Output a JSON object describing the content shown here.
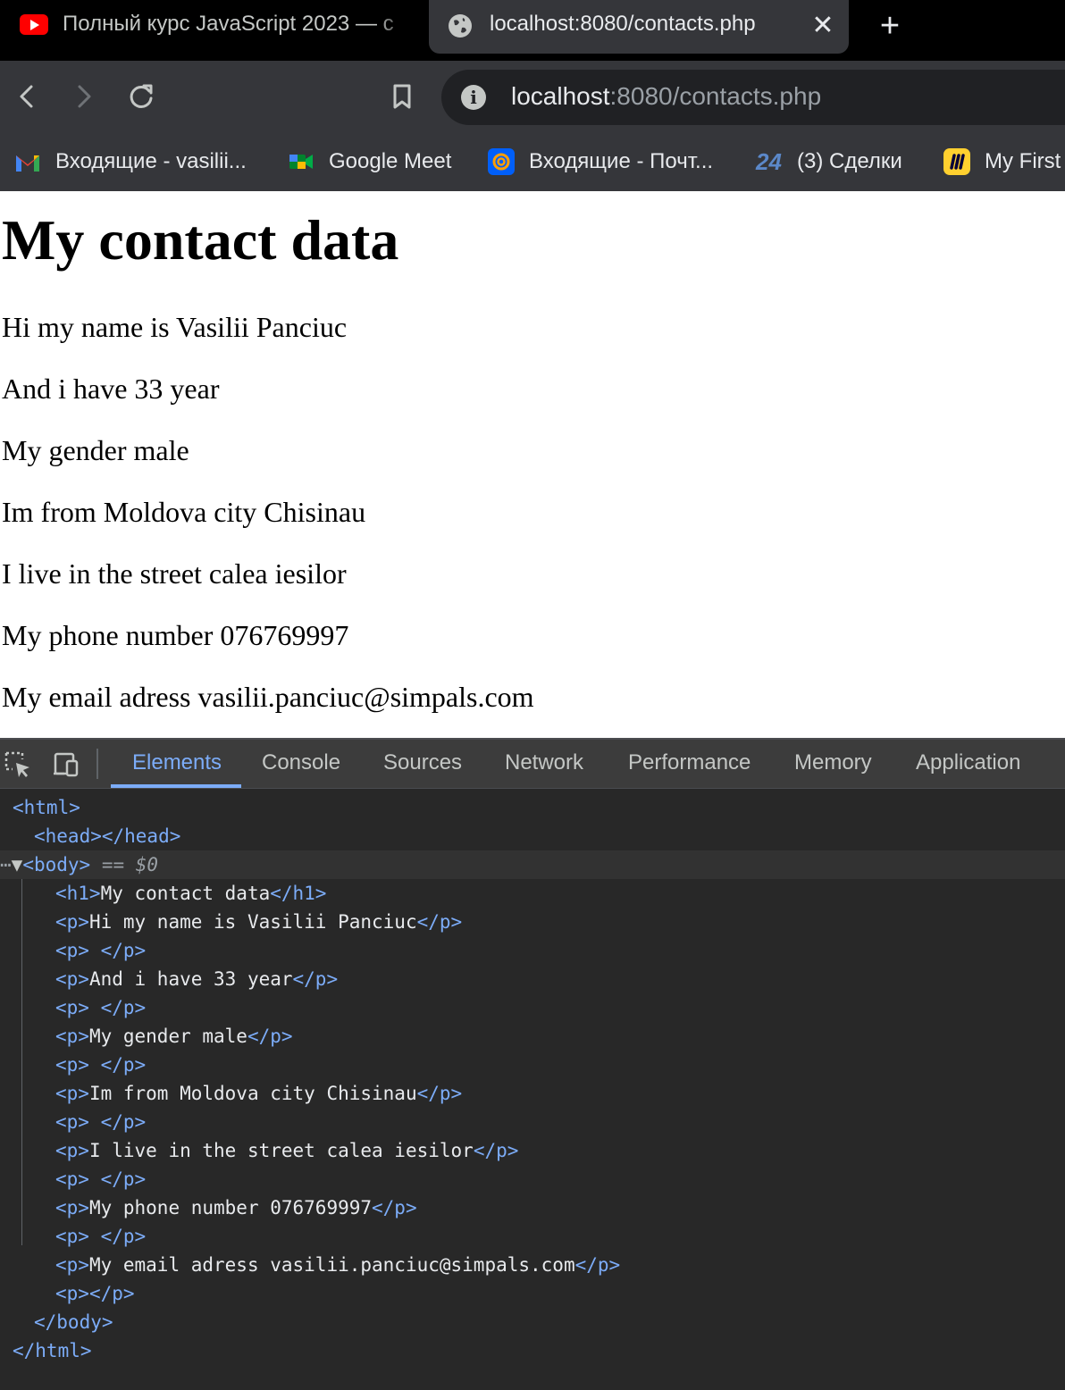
{
  "browser": {
    "tabs": [
      {
        "title": "Полный курс JavaScript 2023 — с",
        "icon": "youtube-icon",
        "active": false
      },
      {
        "title": "localhost:8080/contacts.php",
        "icon": "globe-icon",
        "active": true,
        "close": "✕"
      }
    ],
    "new_tab": "+",
    "url_host": "localhost",
    "url_rest": ":8080/contacts.php",
    "bookmarks": [
      {
        "label": "Входящие - vasilii...",
        "icon": "gmail-icon"
      },
      {
        "label": "Google Meet",
        "icon": "google-meet-icon"
      },
      {
        "label": "Входящие - Почт...",
        "icon": "mail-ru-icon"
      },
      {
        "label": "(3) Сделки",
        "icon": "bitrix24-icon",
        "icon_text": "24"
      },
      {
        "label": "My First",
        "icon": "miro-icon"
      }
    ]
  },
  "page": {
    "heading": "My contact data",
    "paragraphs": [
      "Hi my name is Vasilii Panciuc",
      "And i have 33 year",
      "My gender male",
      "Im from Moldova city Chisinau",
      "I live in the street calea iesilor",
      "My phone number 076769997",
      "My email adress vasilii.panciuc@simpals.com"
    ]
  },
  "devtools": {
    "tabs": [
      "Elements",
      "Console",
      "Sources",
      "Network",
      "Performance",
      "Memory",
      "Application"
    ],
    "active_tab": "Elements",
    "selected_marker": "== $0",
    "row_dots": "⋯",
    "tokens": {
      "html_open": "<html>",
      "html_close": "</html>",
      "head": "<head></head>",
      "body_open": "<body>",
      "body_close": "</body>",
      "h1_open": "<h1>",
      "h1_close": "</h1>",
      "p_open": "<p>",
      "p_close": "</p>",
      "space": " "
    },
    "dom_text": {
      "h1": "My contact data",
      "p1": "Hi my name is Vasilii Panciuc",
      "p2": "And i have 33 year",
      "p3": "My gender male",
      "p4": "Im from Moldova city Chisinau",
      "p5": "I live in the street calea iesilor",
      "p6": "My phone number 076769997",
      "p7": "My email adress vasilii.panciuc@simpals.com"
    }
  }
}
